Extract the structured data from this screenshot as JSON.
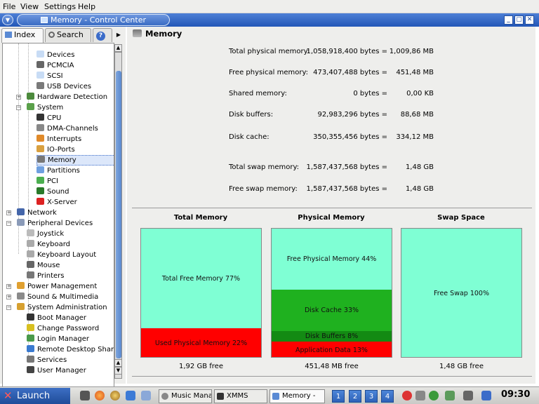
{
  "menu": [
    "File",
    "View",
    "Settings",
    "Help"
  ],
  "window": {
    "title": "Memory - Control Center",
    "buttons": [
      "_",
      "▢",
      "✕"
    ]
  },
  "sidebar": {
    "tabs": {
      "index": "Index",
      "search": "Search",
      "help": "?"
    },
    "tree": [
      {
        "label": "Devices"
      },
      {
        "label": "PCMCIA"
      },
      {
        "label": "SCSI"
      },
      {
        "label": "USB Devices"
      },
      {
        "label": "Hardware Detection"
      },
      {
        "label": "System"
      },
      {
        "label": "CPU"
      },
      {
        "label": "DMA-Channels"
      },
      {
        "label": "Interrupts"
      },
      {
        "label": "IO-Ports"
      },
      {
        "label": "Memory"
      },
      {
        "label": "Partitions"
      },
      {
        "label": "PCI"
      },
      {
        "label": "Sound"
      },
      {
        "label": "X-Server"
      },
      {
        "label": "Network"
      },
      {
        "label": "Peripheral Devices"
      },
      {
        "label": "Joystick"
      },
      {
        "label": "Keyboard"
      },
      {
        "label": "Keyboard Layout"
      },
      {
        "label": "Mouse"
      },
      {
        "label": "Printers"
      },
      {
        "label": "Power Management"
      },
      {
        "label": "Sound & Multimedia"
      },
      {
        "label": "System Administration"
      },
      {
        "label": "Boot Manager"
      },
      {
        "label": "Change Password"
      },
      {
        "label": "Login Manager"
      },
      {
        "label": "Remote Desktop Shari"
      },
      {
        "label": "Services"
      },
      {
        "label": "User Manager"
      }
    ]
  },
  "content": {
    "title": "Memory",
    "stats": [
      {
        "label": "Total physical memory:",
        "bytes": "1,058,918,400 bytes =",
        "size": "1,009,86 MB"
      },
      {
        "label": "Free physical memory:",
        "bytes": "473,407,488 bytes =",
        "size": "451,48 MB"
      },
      {
        "label": "Shared memory:",
        "bytes": "0 bytes =",
        "size": "0,00 KB"
      },
      {
        "label": "Disk buffers:",
        "bytes": "92,983,296 bytes =",
        "size": "88,68 MB"
      },
      {
        "label": "Disk cache:",
        "bytes": "350,355,456 bytes =",
        "size": "334,12 MB"
      },
      {
        "label": "Total swap memory:",
        "bytes": "1,587,437,568 bytes =",
        "size": "1,48 GB"
      },
      {
        "label": "Free swap memory:",
        "bytes": "1,587,437,568 bytes =",
        "size": "1,48 GB"
      }
    ],
    "graphs": [
      {
        "title": "Total Memory",
        "footer": "1,92 GB free",
        "segments": [
          {
            "label": "Total Free Memory 77%",
            "percent": 77,
            "color": "#7fffd4"
          },
          {
            "label": "Used Physical Memory 22%",
            "percent": 23,
            "color": "#ff0000"
          }
        ]
      },
      {
        "title": "Physical Memory",
        "footer": "451,48 MB free",
        "segments": [
          {
            "label": "Free Physical Memory 44%",
            "percent": 47,
            "color": "#7fffd4"
          },
          {
            "label": "Disk Cache 33%",
            "percent": 32,
            "color": "#1fb11f"
          },
          {
            "label": "Disk Buffers 8%",
            "percent": 8,
            "color": "#138a13"
          },
          {
            "label": "Application Data 13%",
            "percent": 13,
            "color": "#ff0000"
          }
        ]
      },
      {
        "title": "Swap Space",
        "footer": "1,48 GB free",
        "segments": [
          {
            "label": "Free Swap 100%",
            "percent": 100,
            "color": "#7fffd4"
          }
        ]
      }
    ]
  },
  "taskbar": {
    "launch": "Launch",
    "tasks": [
      {
        "label": "Music Mana"
      },
      {
        "label": "XMMS"
      },
      {
        "label": "Memory -"
      }
    ],
    "desktops": [
      "1",
      "2",
      "3",
      "4"
    ],
    "clock": "09:30"
  }
}
